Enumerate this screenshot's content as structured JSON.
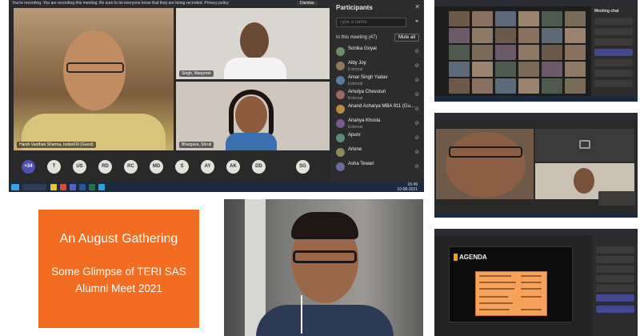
{
  "title_card": {
    "heading": "An August Gathering",
    "line1": "Some Glimpse of TERI SAS",
    "line2": "Alumni Meet 2021",
    "background": "#f26d21"
  },
  "main_meeting": {
    "recording_banner": "You're recording. You are recording this meeting. Be sure to let everyone know that they are being recorded. Privacy policy",
    "dismiss_label": "Dismiss",
    "tiles": [
      {
        "name": "Harsh Vardhan Sharma, IndianOil (Guest)"
      },
      {
        "name": "Singh, Manpreet"
      },
      {
        "name": "Bhargava, Shruti"
      }
    ],
    "participants_panel": {
      "title": "Participants",
      "search_placeholder": "Type a name",
      "in_meeting": "In this meeting (47)",
      "mute_all": "Mute all",
      "people": [
        {
          "name": "Sonika Goyal",
          "sub": "",
          "color": "#6b8e6b"
        },
        {
          "name": "Alby Joy",
          "sub": "External",
          "color": "#8a7a5a"
        },
        {
          "name": "Amar Singh Yadav",
          "sub": "External",
          "color": "#5a7a9a"
        },
        {
          "name": "Amulya Chevuturi",
          "sub": "External",
          "color": "#9a6a6a"
        },
        {
          "name": "Anand Acharya MBA 911 (Gu...",
          "sub": "",
          "color": "#b78a4a"
        },
        {
          "name": "Ananya Khosla",
          "sub": "External",
          "color": "#7a5a8a"
        },
        {
          "name": "Apurv",
          "sub": "",
          "color": "#5a8a7a"
        },
        {
          "name": "Arlene",
          "sub": "",
          "color": "#8a8a5a"
        },
        {
          "name": "Asha Tewari",
          "sub": "",
          "color": "#6a6a9a"
        }
      ]
    },
    "avatar_strip": [
      "+34",
      "T",
      "US",
      "RD",
      "RC",
      "MD",
      "S",
      "AY",
      "AK",
      "DD",
      "SG"
    ],
    "taskbar_time": "15:49",
    "taskbar_date": "10-08-2021"
  },
  "grid_shot": {
    "chat_title": "Meeting chat"
  },
  "agenda_shot": {
    "slide_title": "AGENDA"
  }
}
